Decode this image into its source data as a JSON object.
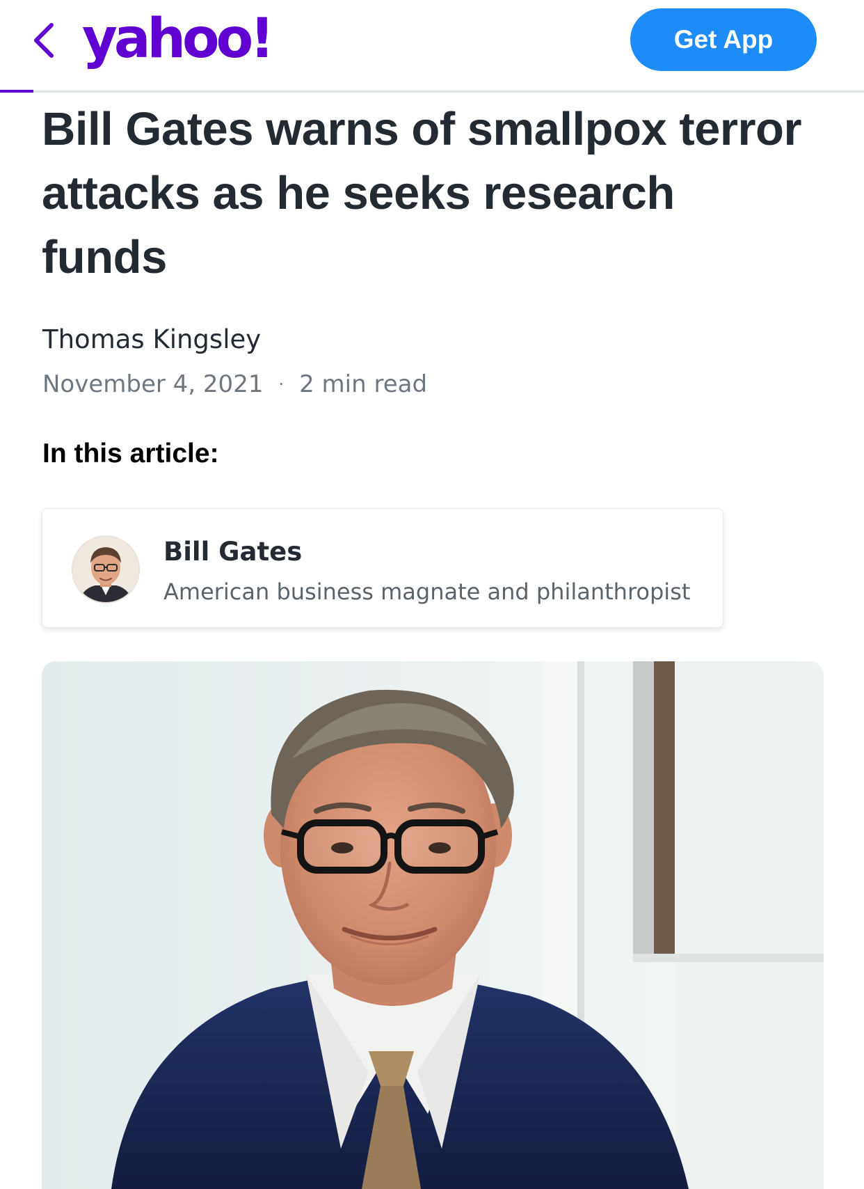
{
  "topbar": {
    "back_icon": "chevron-left-icon",
    "logo_text": "yahoo!",
    "get_app_label": "Get App",
    "brand_color": "#6001d2",
    "button_color": "#1d8cf8"
  },
  "article": {
    "headline": "Bill Gates warns of smallpox terror attacks as he seeks research funds",
    "author": "Thomas Kingsley",
    "date": "November 4, 2021",
    "separator": "·",
    "read_time": "2 min read"
  },
  "in_this_article": {
    "heading": "In this article:",
    "entities": [
      {
        "name": "Bill Gates",
        "description": "American business magnate and philanthropist"
      }
    ]
  }
}
